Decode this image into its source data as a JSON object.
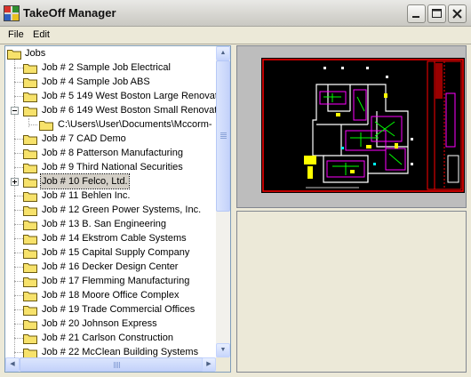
{
  "window": {
    "title": "TakeOff Manager"
  },
  "menu": [
    {
      "label": "File"
    },
    {
      "label": "Edit"
    }
  ],
  "tree": {
    "root_label": "Jobs",
    "items": [
      {
        "label": "Job # 2 Sample Job Electrical"
      },
      {
        "label": "Job # 4 Sample Job ABS"
      },
      {
        "label": "Job # 5 149 West Boston Large Renovat"
      },
      {
        "label": "Job # 6 149 West Boston Small Renovat",
        "expanded": true
      },
      {
        "label": "C:\\Users\\User\\Documents\\Mccorm-",
        "child": true
      },
      {
        "label": "Job # 7 CAD Demo"
      },
      {
        "label": "Job # 8 Patterson Manufacturing"
      },
      {
        "label": "Job # 9 Third National Securities"
      },
      {
        "label": "Job # 10 Felco, Ltd.",
        "selected": true,
        "collapsed": true
      },
      {
        "label": "Job # 11 Behlen Inc."
      },
      {
        "label": "Job # 12 Green Power Systems, Inc."
      },
      {
        "label": "Job # 13 B. San Engineering"
      },
      {
        "label": "Job # 14 Ekstrom Cable Systems"
      },
      {
        "label": "Job # 15 Capital Supply Company"
      },
      {
        "label": "Job # 16 Decker Design Center"
      },
      {
        "label": "Job # 17 Flemming Manufacturing"
      },
      {
        "label": "Job # 18 Moore Office Complex"
      },
      {
        "label": "Job # 19 Trade Commercial Offices"
      },
      {
        "label": "Job # 20 Johnson Express"
      },
      {
        "label": "Job # 21 Carlson Construction"
      },
      {
        "label": "Job # 22 McClean Building Systems"
      }
    ]
  },
  "icons": {
    "folder": "folder-icon",
    "app": "app-icon",
    "minimize": "minimize-icon",
    "maximize": "maximize-icon",
    "close": "close-icon"
  },
  "colors": {
    "folder_fill": "#f7e26b",
    "close_red": "#c8332b",
    "cad_background": "#000000",
    "cad_red": "#ff0000",
    "cad_magenta": "#ff00ff",
    "cad_green": "#00ff00",
    "cad_yellow": "#ffff00",
    "cad_white": "#ffffff",
    "cad_cyan": "#00ffff"
  }
}
